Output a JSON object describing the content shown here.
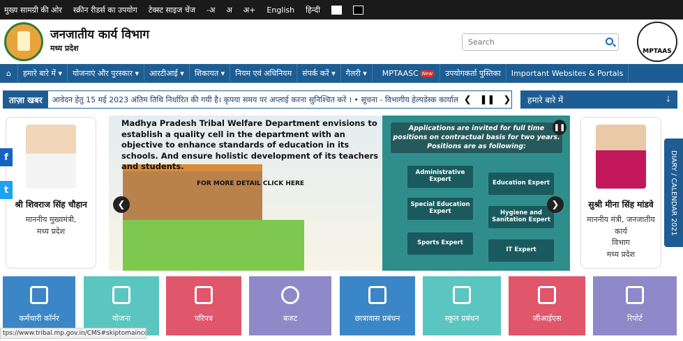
{
  "topbar": {
    "skip": "मुख्य सामग्री की ओर",
    "screen_reader": "स्क्रीन रीडर्स का उपयोग",
    "text_size": "टेक्स्ट साइज चेंज",
    "a_minus": "-अ",
    "a": "अ",
    "a_plus": "अ+",
    "english": "English",
    "hindi": "हिन्दी",
    "swatch_white": "#ffffff",
    "swatch_black": "#000000"
  },
  "header": {
    "dept": "जनजातीय कार्य विभाग",
    "state": "मध्य प्रदेश",
    "search_placeholder": "Search",
    "right_logo": "MPTAAS"
  },
  "nav": {
    "items": [
      "हमारे बारे में ▾",
      "योजनाएं और पुरस्कार ▾",
      "आरटीआई ▾",
      "शिकायत ▾",
      "नियम एवं अधिनियम",
      "संपर्क करें ▾",
      "गैलरी ▾",
      "MPTAASC",
      "उपयोगकर्ता पुस्तिका",
      "Important Websites & Portals"
    ],
    "new_badge": "New"
  },
  "ticker": {
    "label": "ताज़ा खबर",
    "text": "आवेदन हेतु 15 मई 2023 अंतिम तिथि निर्धारित की गयी है। कृपया समय पर अप्लाई करना सुनिश्चित करें ।  • सूचना - विभागीय हेल्पडेस्क कार्यालयीन !",
    "prev": "❮",
    "pause": "❚❚",
    "next": "❯"
  },
  "about": {
    "label": "हमारे बारे में",
    "arrow": "🡓"
  },
  "left_card": {
    "name": "श्री शिवराज सिंह चौहान",
    "role1": "माननीय मुख्यमंत्री,",
    "role2": "मध्य प्रदेश"
  },
  "right_card": {
    "name": "सुश्री मीना सिंह मांडवे",
    "role1": "माननीय मंत्री, जनजातीय कार्य",
    "role2": "विभाग",
    "role3": "मध्य प्रदेश"
  },
  "banner": {
    "headline": "Madhya Pradesh Tribal Welfare Department envisions to establish a quality cell in the department with an objective to enhance standards of education in its schools. And ensure holistic development of its teachers and students.",
    "more": "FOR MORE DETAIL CLICK HERE",
    "apps": "Applications are invited for full time positions on contractual basis for two years. Positions are as following:",
    "roles": [
      "Administrative Expert",
      "Education Expert",
      "Special Education Expert",
      "Hygiene and Sanitation Expert",
      "Sports Expert",
      "IT Expert"
    ],
    "prev": "❮",
    "next": "❯",
    "pause": "❚❚"
  },
  "social": {
    "facebook": "f",
    "twitter": "t"
  },
  "calendar": "DIARY / CALENDAR 2021",
  "tiles": [
    {
      "label": "कर्मचारी कॉर्नर",
      "color": "#3b86c6"
    },
    {
      "label": "योजना",
      "color": "#5bc5bf"
    },
    {
      "label": "परिपत्र",
      "color": "#e0566b"
    },
    {
      "label": "बजट",
      "color": "#8f88c9"
    },
    {
      "label": "छात्रावास प्रबंधन",
      "color": "#3b86c6"
    },
    {
      "label": "स्कूल प्रबंधन",
      "color": "#5bc5bf"
    },
    {
      "label": "जीआईएस",
      "color": "#e0566b"
    },
    {
      "label": "रिपोर्ट",
      "color": "#8f88c9"
    }
  ],
  "status_url": "tps://www.tribal.mp.gov.in/CMS#skiptomaincontent"
}
